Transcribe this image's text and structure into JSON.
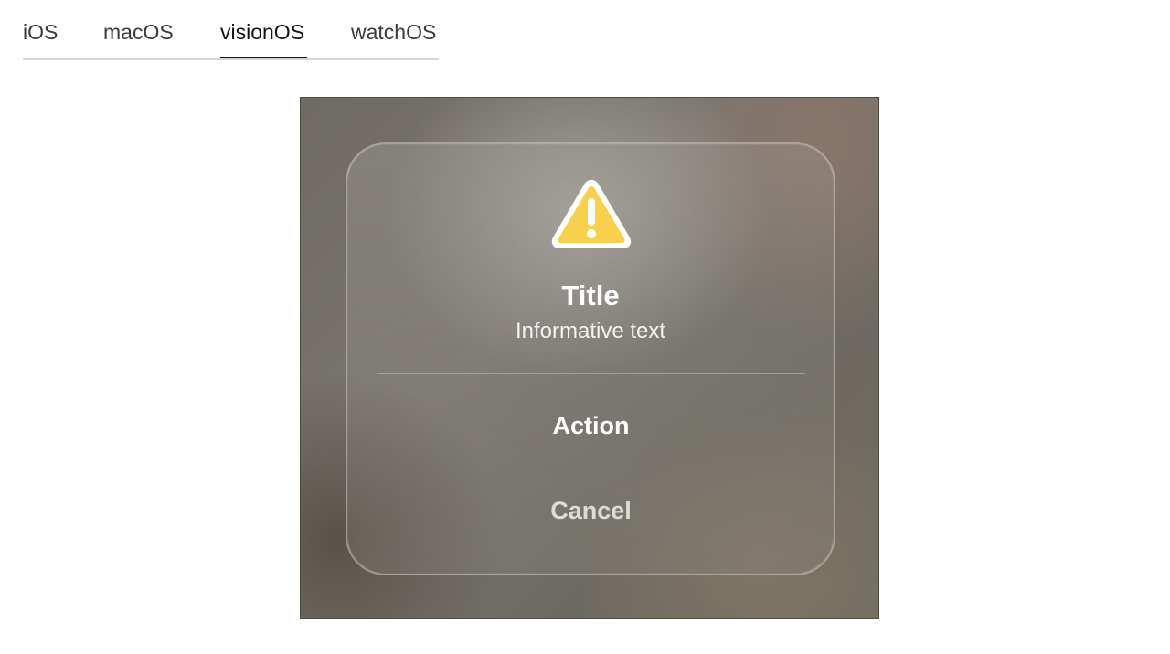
{
  "tabs": [
    {
      "label": "iOS"
    },
    {
      "label": "macOS"
    },
    {
      "label": "visionOS"
    },
    {
      "label": "watchOS"
    }
  ],
  "active_tab": "visionOS",
  "alert": {
    "icon": "warning-triangle-icon",
    "icon_color": "#F7D14D",
    "title": "Title",
    "message": "Informative text",
    "action_label": "Action",
    "cancel_label": "Cancel"
  }
}
